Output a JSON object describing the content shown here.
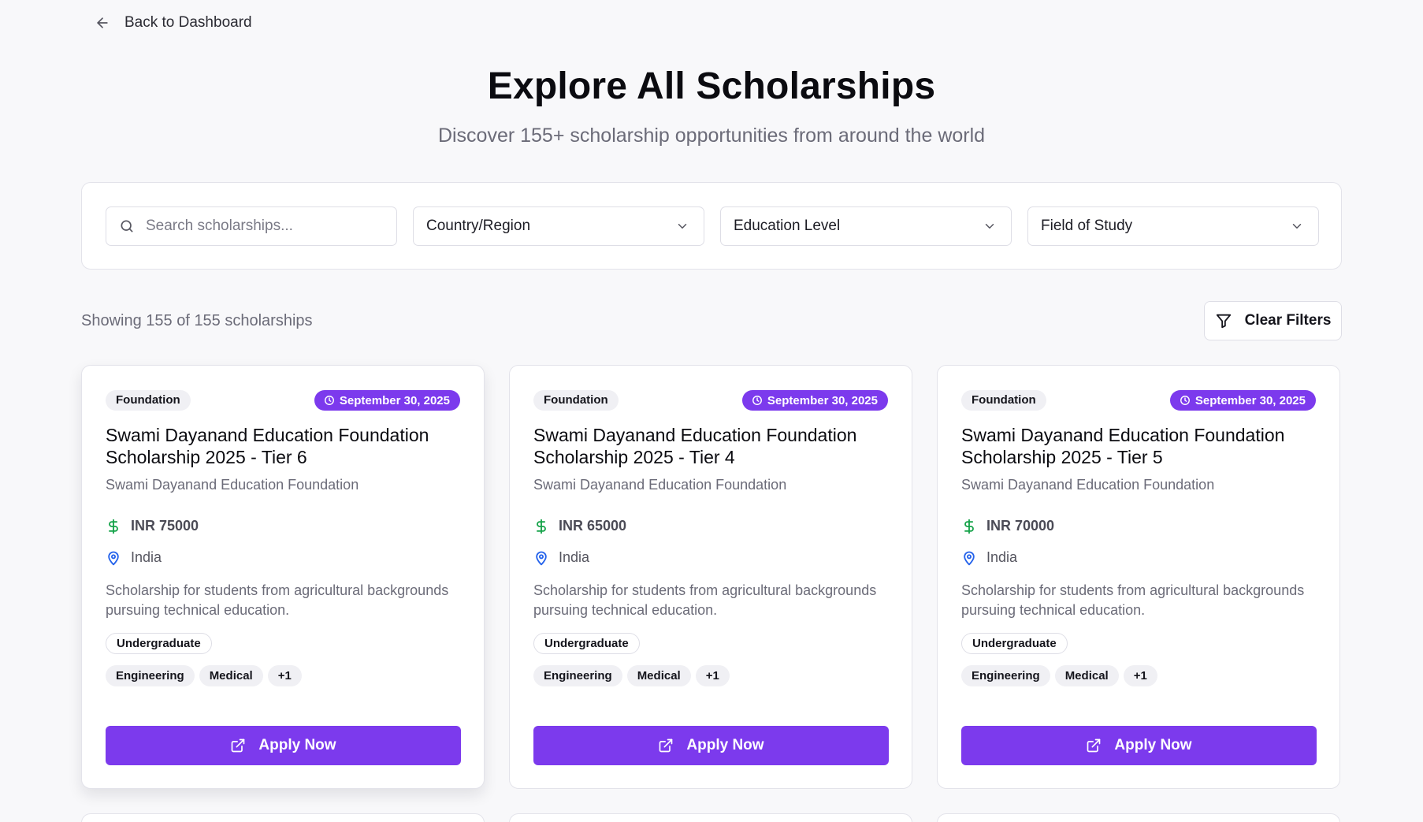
{
  "nav": {
    "back_label": "Back to Dashboard"
  },
  "hero": {
    "title": "Explore All Scholarships",
    "subtitle": "Discover 155+ scholarship opportunities from around the world"
  },
  "filters": {
    "search_placeholder": "Search scholarships...",
    "country_label": "Country/Region",
    "education_label": "Education Level",
    "field_label": "Field of Study"
  },
  "results": {
    "showing_text": "Showing 155 of 155 scholarships",
    "clear_filters_label": "Clear Filters"
  },
  "cards": [
    {
      "type": "Foundation",
      "deadline": "September 30, 2025",
      "title": "Swami Dayanand Education Foundation Scholarship 2025 - Tier 6",
      "organization": "Swami Dayanand Education Foundation",
      "amount": "INR 75000",
      "location": "India",
      "description": "Scholarship for students from agricultural backgrounds pursuing technical education.",
      "level": "Undergraduate",
      "tags": [
        "Engineering",
        "Medical",
        "+1"
      ],
      "apply_label": "Apply Now"
    },
    {
      "type": "Foundation",
      "deadline": "September 30, 2025",
      "title": "Swami Dayanand Education Foundation Scholarship 2025 - Tier 4",
      "organization": "Swami Dayanand Education Foundation",
      "amount": "INR 65000",
      "location": "India",
      "description": "Scholarship for students from agricultural backgrounds pursuing technical education.",
      "level": "Undergraduate",
      "tags": [
        "Engineering",
        "Medical",
        "+1"
      ],
      "apply_label": "Apply Now"
    },
    {
      "type": "Foundation",
      "deadline": "September 30, 2025",
      "title": "Swami Dayanand Education Foundation Scholarship 2025 - Tier 5",
      "organization": "Swami Dayanand Education Foundation",
      "amount": "INR 70000",
      "location": "India",
      "description": "Scholarship for students from agricultural backgrounds pursuing technical education.",
      "level": "Undergraduate",
      "tags": [
        "Engineering",
        "Medical",
        "+1"
      ],
      "apply_label": "Apply Now"
    }
  ],
  "icons": {
    "back": "arrow-left-icon",
    "search": "search-icon",
    "dropdown": "chevron-down-icon",
    "filter": "filter-icon",
    "deadline": "clock-icon",
    "amount": "dollar-icon",
    "location": "map-pin-icon",
    "apply": "external-link-icon"
  },
  "colors": {
    "accent": "#7c3aed",
    "amount_icon": "#16a34a",
    "location_icon": "#2563eb",
    "background": "#f8f8fa"
  }
}
